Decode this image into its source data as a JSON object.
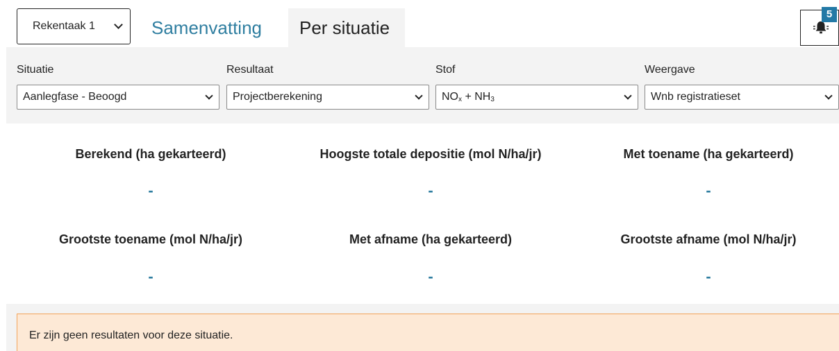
{
  "header": {
    "calc_task_select": "Rekentaak 1",
    "tabs": [
      {
        "label": "Samenvatting",
        "active": false
      },
      {
        "label": "Per situatie",
        "active": true
      }
    ],
    "notification_count": "5",
    "notification_icon": "bell-icon"
  },
  "filters": {
    "situation": {
      "label": "Situatie",
      "value": "Aanlegfase - Beoogd"
    },
    "result": {
      "label": "Resultaat",
      "value": "Projectberekening"
    },
    "substance": {
      "label": "Stof",
      "value_main": "NO",
      "value_sub1": "x",
      "value_mid": " + NH",
      "value_sub2": "3"
    },
    "view": {
      "label": "Weergave",
      "value": "Wnb registratieset"
    }
  },
  "stats": [
    {
      "title": "Berekend (ha gekarteerd)",
      "value": "-"
    },
    {
      "title": "Hoogste totale depositie (mol N/ha/jr)",
      "value": "-"
    },
    {
      "title": "Met toename (ha gekarteerd)",
      "value": "-"
    },
    {
      "title": "Grootste toename (mol N/ha/jr)",
      "value": "-"
    },
    {
      "title": "Met afname (ha gekarteerd)",
      "value": "-"
    },
    {
      "title": "Grootste afname (mol N/ha/jr)",
      "value": "-"
    }
  ],
  "notice": {
    "text": "Er zijn geen resultaten voor deze situatie."
  },
  "colors": {
    "accent": "#2f7ea0",
    "badge": "#2379a6",
    "notice_bg": "#fde9d6",
    "notice_border": "#f2a35a",
    "panel_bg": "#f3f3f3"
  }
}
